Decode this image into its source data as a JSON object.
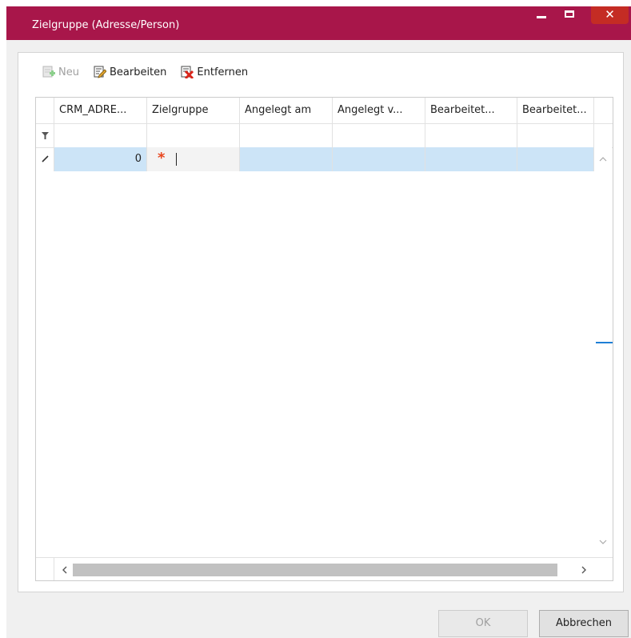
{
  "window": {
    "title": "Zielgruppe (Adresse/Person)",
    "accent_color": "#a8164a",
    "close_color": "#c42c24"
  },
  "toolbar": {
    "new_label": "Neu",
    "edit_label": "Bearbeiten",
    "remove_label": "Entfernen"
  },
  "grid": {
    "columns": [
      "CRM_ADRE...",
      "Zielgruppe",
      "Angelegt am",
      "Angelegt v...",
      "Bearbeitet...",
      "Bearbeitet..."
    ],
    "filter_icon": "filter-icon",
    "edit_row_icon": "pencil-icon",
    "row": {
      "crm_adresse": "0",
      "required_marker": "*"
    },
    "selected_row_color": "#cce4f7"
  },
  "footer": {
    "ok_label": "OK",
    "cancel_label": "Abbrechen"
  }
}
